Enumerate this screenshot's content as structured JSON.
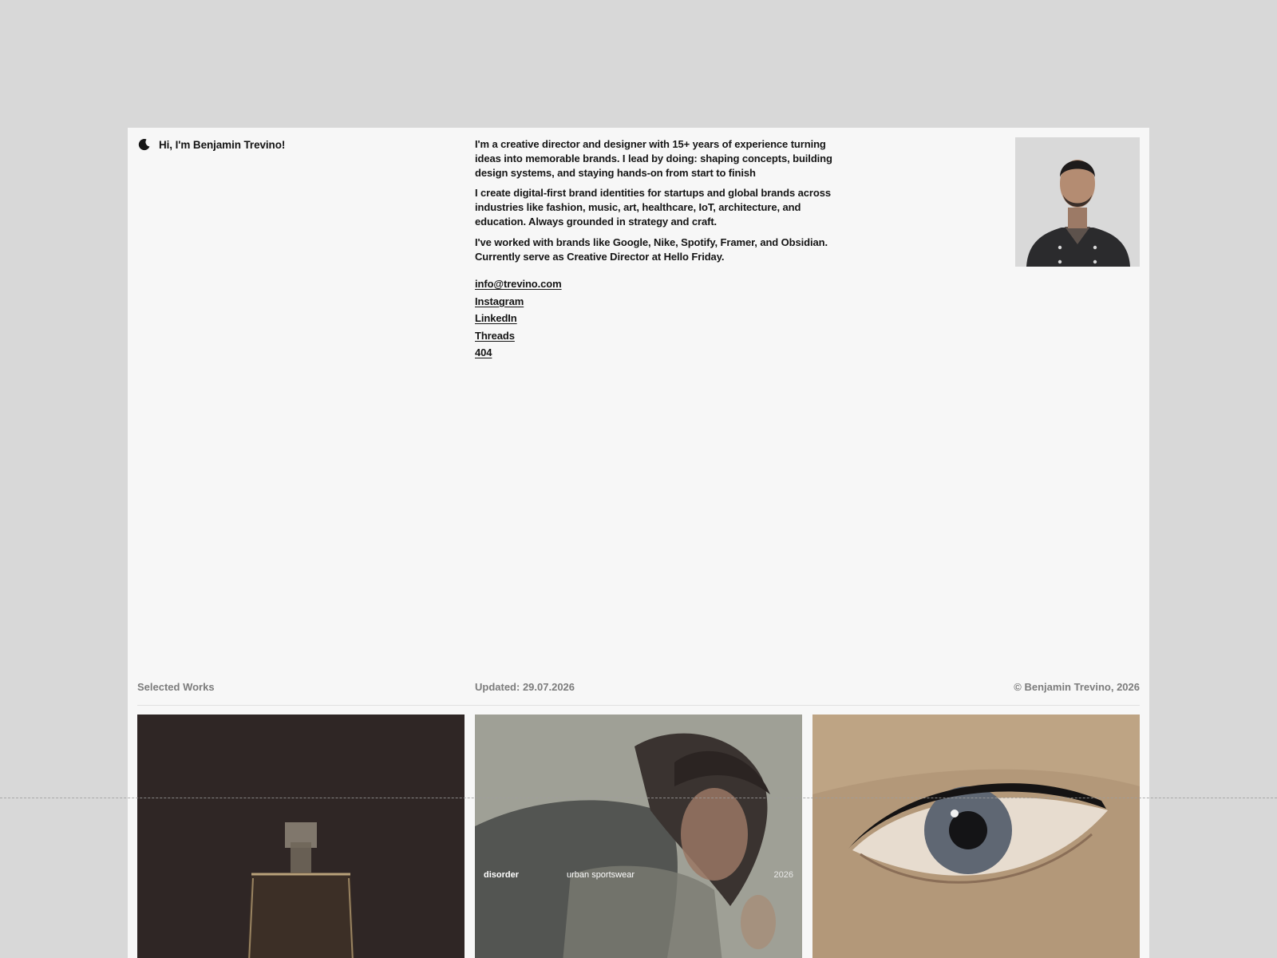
{
  "header": {
    "greeting": "Hi, I'm Benjamin Trevino!",
    "theme_icon": "moon-icon"
  },
  "bio": {
    "paragraphs": [
      "I'm a creative director and designer with 15+ years of experience turning ideas into memorable brands. I lead by doing: shaping concepts, building design systems, and staying hands-on from start to finish",
      "I create digital-first brand identities for startups and global brands across industries like fashion, music, art, healthcare, IoT, architecture, and education. Always grounded in strategy and craft.",
      "I've worked with brands like Google, Nike, Spotify, Framer, and Obsidian. Currently serve as Creative Director at Hello Friday."
    ],
    "links": [
      "info@trevino.com",
      "Instagram",
      "LinkedIn",
      "Threads",
      "404"
    ]
  },
  "section": {
    "label": "Selected Works",
    "updated": "Updated: 29.07.2026",
    "copyright": "© Benjamin Trevino, 2026"
  },
  "works": [
    {
      "title": "",
      "category": "",
      "year": ""
    },
    {
      "title": "disorder",
      "category": "urban sportswear",
      "year": "2026"
    },
    {
      "title": "",
      "category": "",
      "year": ""
    }
  ],
  "colors": {
    "background": "#d8d8d8",
    "page": "#f7f7f7",
    "text": "#151515",
    "muted": "#7c7c7c"
  }
}
